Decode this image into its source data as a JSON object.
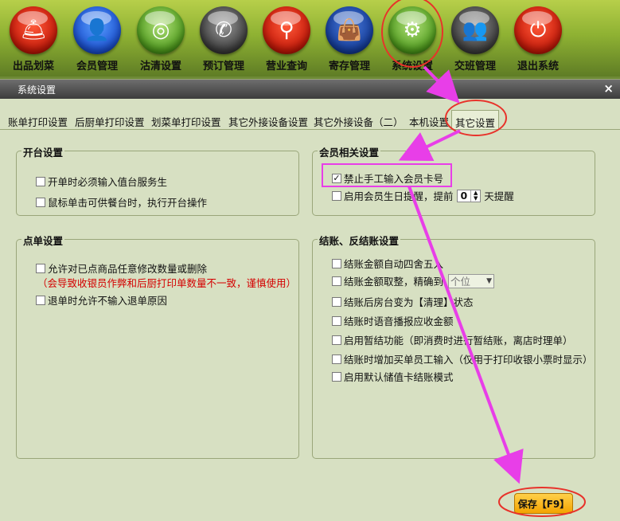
{
  "toolbar": {
    "items": [
      {
        "label": "出品划菜",
        "icon": "cloche-icon"
      },
      {
        "label": "会员管理",
        "icon": "member-icon"
      },
      {
        "label": "沽清设置",
        "icon": "plate-icon"
      },
      {
        "label": "预订管理",
        "icon": "phone-icon"
      },
      {
        "label": "营业查询",
        "icon": "magnifier-icon"
      },
      {
        "label": "寄存管理",
        "icon": "bag-icon"
      },
      {
        "label": "系统设置",
        "icon": "gear-icon"
      },
      {
        "label": "交班管理",
        "icon": "handover-icon"
      },
      {
        "label": "退出系统",
        "icon": "power-icon"
      }
    ]
  },
  "window": {
    "title": "系统设置",
    "close_label": "×"
  },
  "tabs": [
    {
      "label": "账单打印设置",
      "active": false
    },
    {
      "label": "后厨单打印设置",
      "active": false
    },
    {
      "label": "划菜单打印设置",
      "active": false
    },
    {
      "label": "其它外接设备设置",
      "active": false
    },
    {
      "label": "其它外接设备（二）",
      "active": false
    },
    {
      "label": "本机设置",
      "active": false
    },
    {
      "label": "其它设置",
      "active": true
    }
  ],
  "open_table": {
    "title": "开台设置",
    "options": [
      {
        "label": "开单时必须输入值台服务生",
        "checked": false
      },
      {
        "label": "鼠标单击可供餐台时，执行开台操作",
        "checked": false
      }
    ]
  },
  "order": {
    "title": "点单设置",
    "options": [
      {
        "label": "允许对已点商品任意修改数量或删除",
        "checked": false
      },
      {
        "label": "退单时允许不输入退单原因",
        "checked": false
      }
    ],
    "warning": "（会导致收银员作弊和后厨打印单数量不一致，谨慎使用）"
  },
  "member": {
    "title": "会员相关设置",
    "forbid_manual": {
      "label": "禁止手工输入会员卡号",
      "checked": true
    },
    "birthday": {
      "label": "启用会员生日提醒，提前",
      "value": "0",
      "suffix": "天提醒",
      "checked": false
    }
  },
  "checkout": {
    "title": "结账、反结账设置",
    "options": [
      {
        "label": "结账金额自动四舍五入",
        "checked": false
      },
      {
        "label": "结账金额取整，精确到",
        "checked": false
      },
      {
        "label": "结账后房台变为【清理】状态",
        "checked": false
      },
      {
        "label": "结账时语音播报应收金额",
        "checked": false
      },
      {
        "label": "启用暂结功能（即消费时进行暂结账，离店时理单）",
        "checked": false
      },
      {
        "label": "结账时增加买单员工输入（仅用于打印收银小票时显示）",
        "checked": false
      },
      {
        "label": "启用默认储值卡结账模式",
        "checked": false
      }
    ],
    "precision_select": "个位"
  },
  "save_button": "保存【F9】",
  "accent": {
    "annotation_magenta": "#e83ee8",
    "annotation_red": "#e8322a",
    "save_orange": "#f3a300"
  }
}
